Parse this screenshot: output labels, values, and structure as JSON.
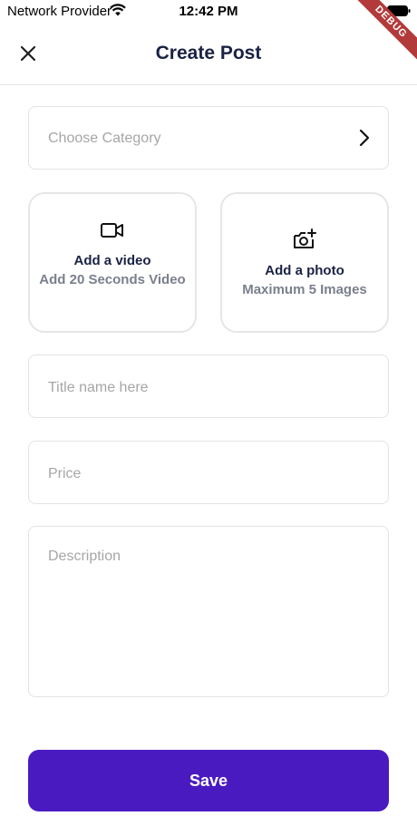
{
  "status_bar": {
    "carrier": "Network Provider",
    "time": "12:42 PM",
    "wifi_icon": "wifi-icon",
    "battery_icon": "battery-icon"
  },
  "debug_banner": "DEBUG",
  "app_bar": {
    "title": "Create Post",
    "close_icon": "close-icon"
  },
  "form": {
    "category": {
      "placeholder": "Choose Category",
      "icon": "chevron-right-icon"
    },
    "video_card": {
      "icon": "video-camera-icon",
      "title": "Add a video",
      "subtitle": "Add 20 Seconds Video"
    },
    "photo_card": {
      "icon": "camera-add-icon",
      "title": "Add a photo",
      "subtitle": "Maximum 5 Images"
    },
    "title_field": {
      "placeholder": "Title name here",
      "value": ""
    },
    "price_field": {
      "placeholder": "Price",
      "value": ""
    },
    "description_field": {
      "placeholder": "Description",
      "value": ""
    }
  },
  "save_label": "Save",
  "colors": {
    "accent": "#4a1ac1",
    "title_text": "#1a2245",
    "muted_text": "#7a7f8c",
    "placeholder": "#a6a6a6",
    "border": "#e3e3e3",
    "debug_ribbon": "#b33a3a"
  }
}
